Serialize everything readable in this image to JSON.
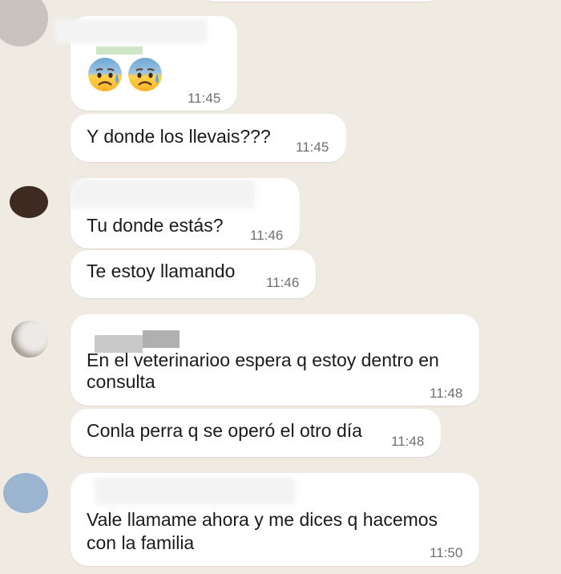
{
  "colors": {
    "chat_background": "#efeae2",
    "bubble_incoming": "#ffffff",
    "timestamp": "#6f6f6f"
  },
  "messages": [
    {
      "emojis": [
        "anxious-face-with-sweat",
        "anxious-face-with-sweat"
      ],
      "time": "11:45"
    },
    {
      "text": "Y donde los llevais???",
      "time": "11:45"
    },
    {
      "text": "Tu donde estás?",
      "time": "11:46"
    },
    {
      "text": "Te estoy llamando",
      "time": "11:46"
    },
    {
      "lines": [
        "En el veterinarioo espera q estoy dentro en",
        "consulta"
      ],
      "time": "11:48"
    },
    {
      "text": "Conla perra q se operó el otro día",
      "time": "11:48"
    },
    {
      "lines": [
        "Vale llamame ahora y me dices q hacemos",
        "con la familia"
      ],
      "time": "11:50"
    }
  ]
}
